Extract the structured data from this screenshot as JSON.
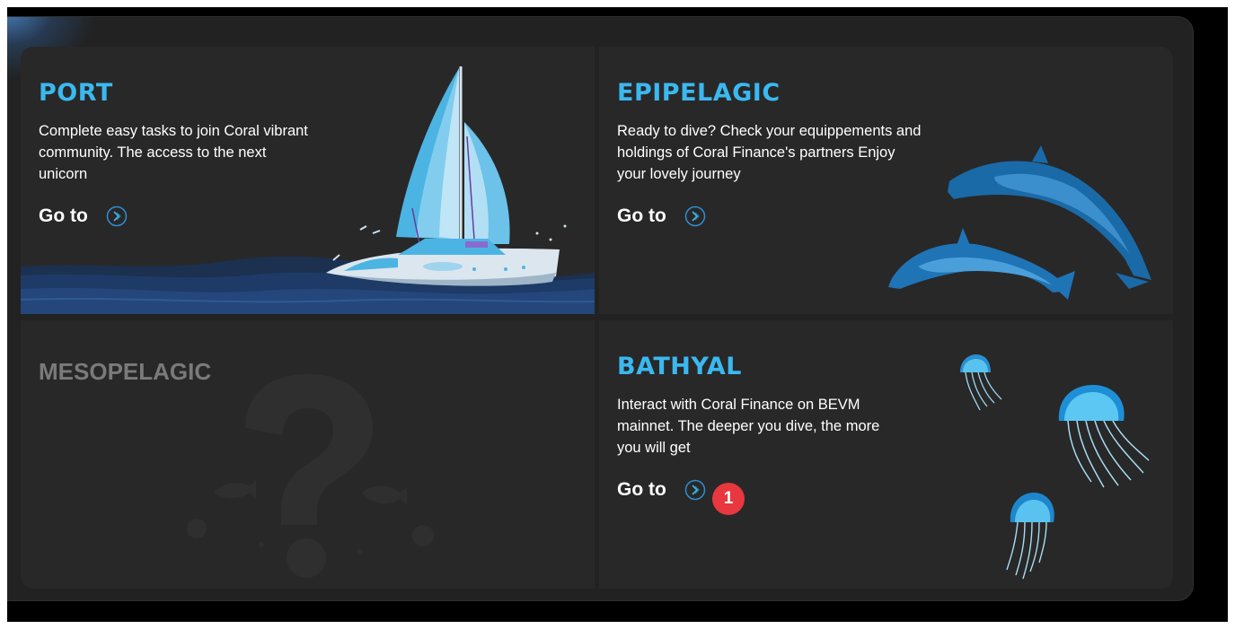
{
  "cards": [
    {
      "title": "PORT",
      "description": "Complete easy tasks to join Coral vibrant community. The access to the next unicorn",
      "goto_label": "Go to"
    },
    {
      "title": "EPIPELAGIC",
      "description": "Ready to dive? Check your equippements and holdings of Coral Finance's partners Enjoy your lovely journey",
      "goto_label": "Go to"
    },
    {
      "title": "MESOPELAGIC",
      "locked": true
    },
    {
      "title": "BATHYAL",
      "description": "Interact with Coral Finance on BEVM mainnet. The deeper you dive, the more you will get",
      "goto_label": "Go to",
      "badge": "1"
    }
  ],
  "colors": {
    "accent": "#3bb8f0",
    "card_bg": "#282828",
    "panel_bg": "#222222",
    "badge": "#e8373f",
    "locked_text": "#7a7a7a"
  },
  "icons": {
    "goto": "chevron-right-circle-icon",
    "locked": "question-mark-icon"
  }
}
